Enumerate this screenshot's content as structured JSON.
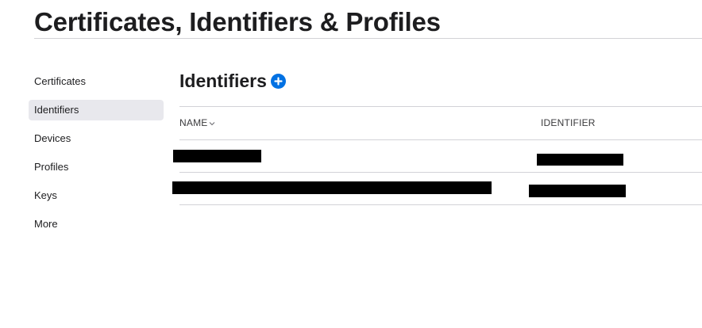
{
  "header": {
    "title": "Certificates, Identifiers & Profiles"
  },
  "sidebar": {
    "items": [
      {
        "label": "Certificates"
      },
      {
        "label": "Identifiers",
        "active": true
      },
      {
        "label": "Devices"
      },
      {
        "label": "Profiles"
      },
      {
        "label": "Keys"
      },
      {
        "label": "More"
      }
    ]
  },
  "section": {
    "title": "Identifiers",
    "add_icon": "plus-circle-icon"
  },
  "table": {
    "columns": {
      "name": "NAME",
      "identifier": "IDENTIFIER"
    },
    "sort_icon": "chevron-down-icon",
    "rows": [
      {
        "name": "",
        "identifier": "",
        "redacted": true
      },
      {
        "name": "",
        "identifier": "",
        "redacted": true
      }
    ]
  },
  "colors": {
    "accent": "#0071e3",
    "active_bg": "#e8e8ed",
    "divider": "#d2d2d7",
    "redaction": "#000000"
  }
}
